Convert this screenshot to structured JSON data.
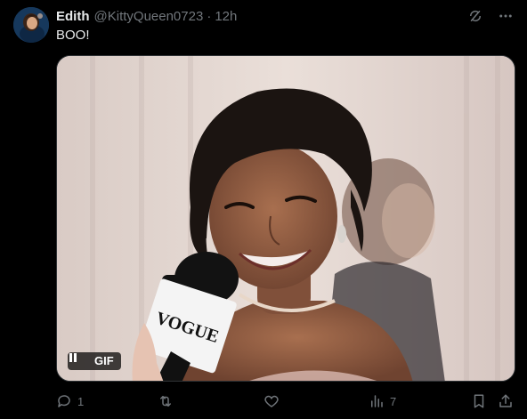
{
  "tweet": {
    "author_name": "Edith",
    "author_handle": "@KittyQueen0723",
    "separator": "·",
    "time": "12h",
    "text": "BOO!",
    "media": {
      "badge": "GIF",
      "mic_brand": "VOGUE"
    }
  },
  "actions": {
    "reply_count": "1",
    "retweet_count": "",
    "like_count": "",
    "view_count": "7"
  },
  "colors": {
    "background": "#000000",
    "text_primary": "#e7e9ea",
    "text_secondary": "#71767b",
    "border": "#2f3336"
  },
  "icons": {
    "grok": "grok-icon",
    "more": "more-icon",
    "reply": "reply-icon",
    "retweet": "retweet-icon",
    "like": "like-icon",
    "views": "views-icon",
    "bookmark": "bookmark-icon",
    "share": "share-icon",
    "pause": "pause-icon"
  }
}
